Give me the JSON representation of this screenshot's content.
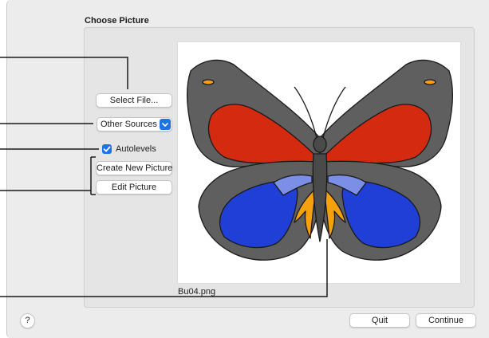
{
  "group": {
    "title": "Choose Picture"
  },
  "buttons": {
    "select_file": "Select File...",
    "create_new_picture": "Create New Picture",
    "edit_picture": "Edit Picture",
    "quit": "Quit",
    "continue": "Continue",
    "help": "?"
  },
  "source_popup": {
    "selected": "Other Sources"
  },
  "autolevels": {
    "label": "Autolevels",
    "checked": true
  },
  "preview": {
    "filename": "Bu04.png",
    "image": "butterfly-picture"
  },
  "colors": {
    "accent": "#1a73e8",
    "wing_gray": "#5f5f5f",
    "wing_red": "#d42a0f",
    "wing_blue": "#1f3fd6",
    "wing_light_blue": "#7b8fe6",
    "wing_orange": "#f5a00f"
  },
  "icons": [
    "chevron-updown-icon",
    "checkmark-icon",
    "callout-lines"
  ]
}
